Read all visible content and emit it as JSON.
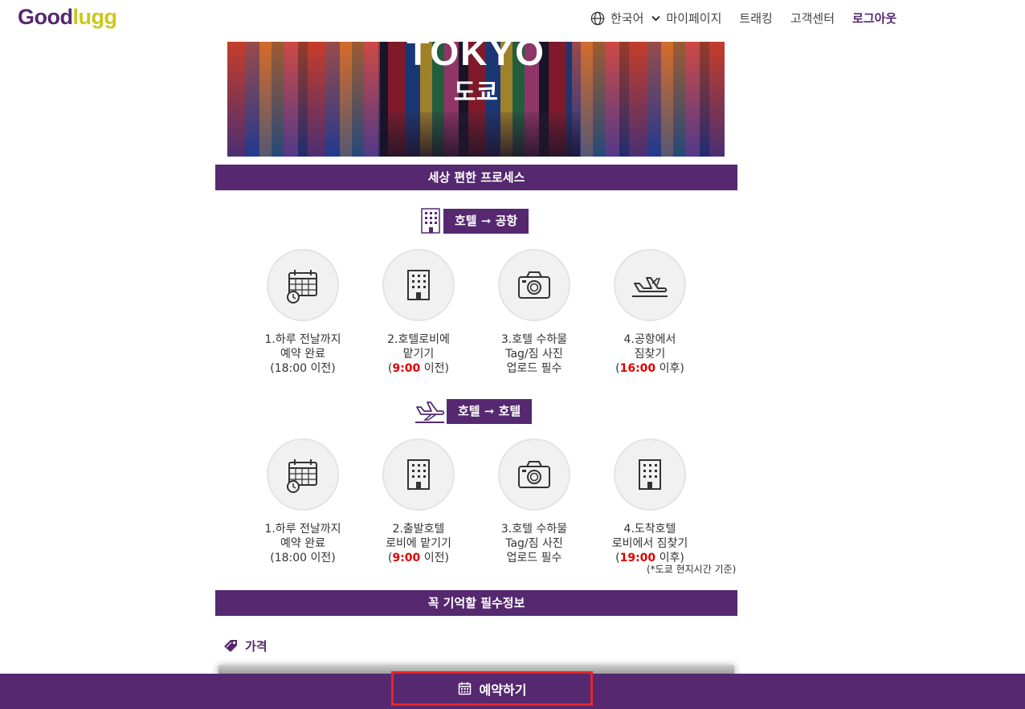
{
  "header": {
    "logo_good": "Good",
    "logo_lugg": "lugg",
    "language": "한국어",
    "nav": [
      "마이페이지",
      "트래킹",
      "고객센터"
    ],
    "logout": "로그아웃"
  },
  "hero": {
    "title_en": "TOKYO",
    "title_ko": "도쿄"
  },
  "process_section": {
    "title": "세상 편한 프로세스",
    "hotel_to_airport": {
      "label": "호텔 ➞ 공항",
      "steps": [
        {
          "icon": "calendar-icon",
          "line1": "1.하루 전날까지",
          "line2": "예약 완료",
          "line3": "(18:00 이전)"
        },
        {
          "icon": "building-icon",
          "line1": "2.호텔로비에",
          "line2": "맡기기",
          "time_prefix": "(",
          "time": "9:00",
          "time_suffix": " 이전)"
        },
        {
          "icon": "camera-icon",
          "line1": "3.호텔 수하물",
          "line2": "Tag/짐 사진",
          "line3": "업로드 필수"
        },
        {
          "icon": "airplane-landing-icon",
          "line1": "4.공항에서",
          "line2": "짐찾기",
          "time_prefix": "(",
          "time": "16:00",
          "time_suffix": " 이후)"
        }
      ]
    },
    "hotel_to_hotel": {
      "label": "호텔 ➞ 호텔",
      "steps": [
        {
          "icon": "calendar-icon",
          "line1": "1.하루 전날까지",
          "line2": "예약 완료",
          "line3": "(18:00 이전)"
        },
        {
          "icon": "building-icon",
          "line1": "2.출발호텔",
          "line2": "로비에 맡기기",
          "time_prefix": "(",
          "time": "9:00",
          "time_suffix": " 이전)"
        },
        {
          "icon": "camera-icon",
          "line1": "3.호텔 수하물",
          "line2": "Tag/짐 사진",
          "line3": "업로드 필수"
        },
        {
          "icon": "building-icon",
          "line1": "4.도착호텔",
          "line2": "로비에서 짐찾기",
          "time_prefix": "(",
          "time": "19:00",
          "time_suffix": " 이후)"
        }
      ]
    },
    "note": "(*도쿄 현지시간 기준)"
  },
  "info_section": {
    "title": "꼭 기억할 필수정보",
    "price_label": "가격"
  },
  "bottom": {
    "reserve_label": "예약하기"
  },
  "colors": {
    "brand_purple": "#55286f",
    "brand_lime": "#c9c81c",
    "highlight_red": "#e00000",
    "focus_outline": "#e3262d"
  }
}
